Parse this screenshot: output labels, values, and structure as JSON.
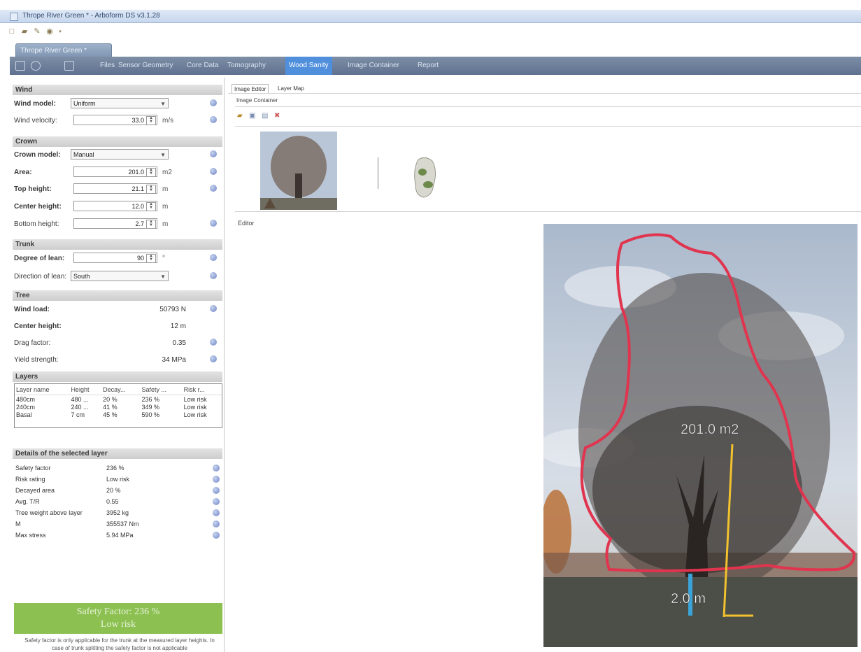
{
  "window": {
    "title": "Thrope River Green *  -  Arboform DS v3.1.28"
  },
  "quick_access": [
    "new-icon",
    "open-icon",
    "edit-icon",
    "help-icon"
  ],
  "document_tab": {
    "label": "Thrope River Green *"
  },
  "ribbon": {
    "tabs": [
      "Files",
      "Sensor Geometry",
      "Core Data",
      "Tomography",
      "Wood Sanity",
      "Image Container",
      "Report"
    ],
    "active_tab": "Wood Sanity",
    "accent": "#4f8fdc"
  },
  "wind": {
    "header": "Wind",
    "model_label": "Wind model:",
    "model_value": "Uniform",
    "velocity_label": "Wind velocity:",
    "velocity_value": "33.0",
    "velocity_unit": "m/s"
  },
  "crown": {
    "header": "Crown",
    "model_label": "Crown model:",
    "model_value": "Manual",
    "area_label": "Area:",
    "area_value": "201.0",
    "area_unit": "m2",
    "top_label": "Top height:",
    "top_value": "21.1",
    "top_unit": "m",
    "center_label": "Center height:",
    "center_value": "12.0",
    "center_unit": "m",
    "bottom_label": "Bottom height:",
    "bottom_value": "2.7",
    "bottom_unit": "m"
  },
  "trunk": {
    "header": "Trunk",
    "lean_label": "Degree of lean:",
    "lean_value": "90",
    "lean_unit": "°",
    "dir_label": "Direction of lean:",
    "dir_value": "South"
  },
  "tree": {
    "header": "Tree",
    "rows": [
      {
        "label": "Wind load:",
        "value": "50793 N"
      },
      {
        "label": "Center height:",
        "value": "12 m"
      },
      {
        "label": "Drag factor:",
        "value": "0.35"
      },
      {
        "label": "Yield strength:",
        "value": "34 MPa"
      }
    ]
  },
  "layers": {
    "header": "Layers",
    "columns": [
      "Layer name",
      "Height",
      "Decay...",
      "Safety ...",
      "Risk r..."
    ],
    "rows": [
      [
        "480cm",
        "480 ...",
        "20 %",
        "236 %",
        "Low risk"
      ],
      [
        "240cm",
        "240 ...",
        "41 %",
        "349 %",
        "Low risk"
      ],
      [
        "Basal",
        "7 cm",
        "45 %",
        "590 %",
        "Low risk"
      ]
    ]
  },
  "details": {
    "header": "Details of the selected layer",
    "rows": [
      {
        "label": "Safety factor",
        "value": "236 %"
      },
      {
        "label": "Risk rating",
        "value": "Low risk"
      },
      {
        "label": "Decayed area",
        "value": "20 %"
      },
      {
        "label": "Avg. T/R",
        "value": "0.55"
      },
      {
        "label": "Tree weight above layer",
        "value": "3952 kg"
      },
      {
        "label": "M",
        "value": "355537 Nm"
      },
      {
        "label": "Max stress",
        "value": "5.94 MPa"
      }
    ]
  },
  "safety": {
    "line1": "Safety Factor: 236 %",
    "line2": "Low risk",
    "color": "#8cc152"
  },
  "note": {
    "text": "Safety factor is only applicable for the trunk at the measured layer heights. In case of trunk splitting the safety factor is not applicable"
  },
  "right": {
    "tabs": [
      "Image Editor",
      "Layer Map"
    ],
    "container_label": "Image Container",
    "editor_label": "Editor",
    "toolbar": [
      "folder-icon",
      "copy-icon",
      "paste-icon",
      "delete-icon"
    ]
  },
  "image": {
    "area_label": "201.0 m2",
    "height_label": "2.0 m",
    "outline_color": "#e0344f",
    "measure_color": "#f2c12e",
    "scale_color": "#3aa3d8"
  }
}
